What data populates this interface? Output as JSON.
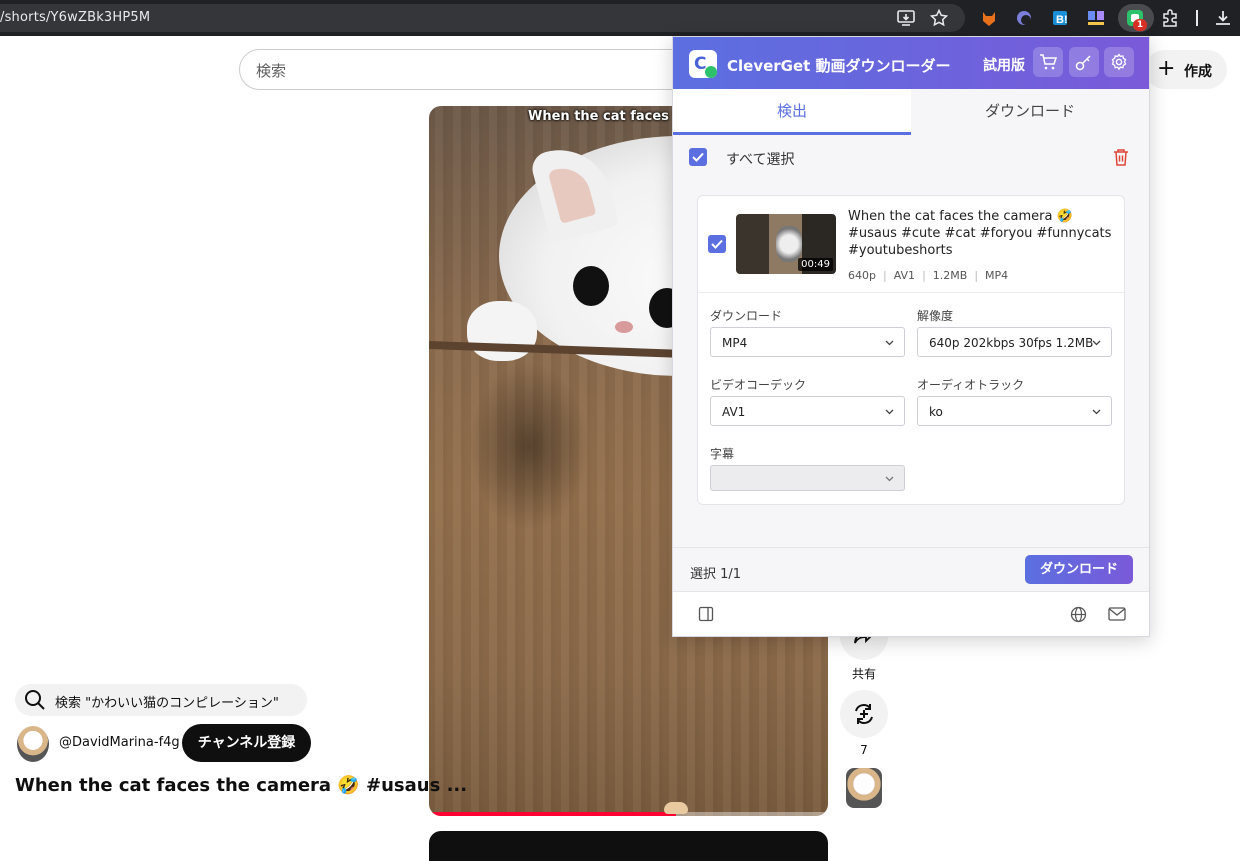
{
  "browser": {
    "url": "/shorts/Y6wZBk3HP5M",
    "extension_badge": "1",
    "icons": [
      "install-app-icon",
      "star-icon",
      "extension-fox-icon",
      "extension-arc-icon",
      "extension-b-icon",
      "extension-blocks-icon",
      "cleverget-extension-icon",
      "puzzle-icon",
      "download-icon"
    ]
  },
  "youtube": {
    "search_placeholder": "検索",
    "create_label": "作成",
    "video_caption": "When the cat faces the",
    "progress_fraction": 0.62,
    "search_suggestion": "検索 \"かわいい猫のコンピレーション\"",
    "channel_name": "@DavidMarina-f4g",
    "subscribe_label": "チャンネル登録",
    "title": "When the cat faces the camera 🤣 #usaus ...",
    "share_label": "共有",
    "remix_count": "7"
  },
  "extension": {
    "title": "CleverGet 動画ダウンローダー",
    "trial_label": "試用版",
    "header_icons": [
      "cart-icon",
      "key-icon",
      "settings-icon"
    ],
    "tabs": [
      {
        "label": "検出",
        "active": true
      },
      {
        "label": "ダウンロード",
        "active": false
      }
    ],
    "select_all_label": "すべて選択",
    "item": {
      "title": "When the cat faces the camera 🤣 #usaus #cute #cat #foryou #funnycats #youtubeshorts",
      "duration": "00:49",
      "meta": [
        "640p",
        "AV1",
        "1.2MB",
        "MP4"
      ],
      "fields": {
        "download_label": "ダウンロード",
        "download_value": "MP4",
        "resolution_label": "解像度",
        "resolution_value": "640p 202kbps 30fps 1.2MB",
        "codec_label": "ビデオコーデック",
        "codec_value": "AV1",
        "audio_label": "オーディオトラック",
        "audio_value": "ko",
        "subtitle_label": "字幕",
        "subtitle_value": ""
      }
    },
    "selected_count": "選択 1/1",
    "download_button": "ダウンロード",
    "accent_color": "#5b6fe0"
  }
}
